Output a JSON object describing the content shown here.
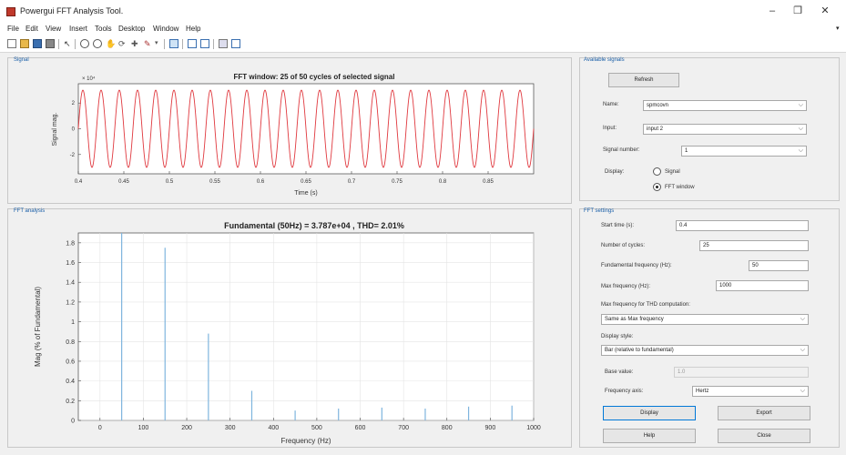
{
  "window": {
    "title": "Powergui FFT Analysis Tool.",
    "minimize": "–",
    "maximize": "❐",
    "close": "✕"
  },
  "menu": [
    "File",
    "Edit",
    "View",
    "Insert",
    "Tools",
    "Desktop",
    "Window",
    "Help"
  ],
  "signal_panel": {
    "title": "Signal",
    "plot_title": "FFT window: 25 of 50 cycles of selected signal",
    "exponent": "× 10⁴",
    "ylabel": "Signal mag.",
    "xlabel": "Time (s)",
    "xticks": [
      "0.4",
      "0.45",
      "0.5",
      "0.55",
      "0.6",
      "0.65",
      "0.7",
      "0.75",
      "0.8",
      "0.85"
    ],
    "yticks": [
      "2",
      "0",
      "-2"
    ]
  },
  "fft_panel": {
    "title": "FFT analysis",
    "plot_title": "Fundamental (50Hz) = 3.787e+04 , THD= 2.01%",
    "ylabel": "Mag (% of Fundamental)",
    "xlabel": "Frequency (Hz)"
  },
  "available_signals": {
    "title": "Available signals",
    "refresh": "Refresh",
    "name_label": "Name:",
    "name_value": "spmcovn",
    "input_label": "Input:",
    "input_value": "input 2",
    "signal_number_label": "Signal number:",
    "signal_number_value": "1",
    "display_label": "Display:",
    "option_signal": "Signal",
    "option_fft": "FFT window",
    "selected_option": "FFT window"
  },
  "fft_settings": {
    "title": "FFT settings",
    "start_time_label": "Start time (s):",
    "start_time_value": "0.4",
    "cycles_label": "Number of cycles:",
    "cycles_value": "25",
    "fund_freq_label": "Fundamental frequency (Hz):",
    "fund_freq_value": "50",
    "max_freq_label": "Max frequency (Hz):",
    "max_freq_value": "1000",
    "thd_label": "Max frequency for THD computation:",
    "thd_value": "Same as Max frequency",
    "display_style_label": "Display style:",
    "display_style_value": "Bar (relative to fundamental)",
    "base_value_label": "Base value:",
    "base_value_value": "1.0",
    "freq_axis_label": "Frequency axis:",
    "freq_axis_value": "Hertz",
    "display_btn": "Display",
    "export_btn": "Export",
    "help_btn": "Help",
    "close_btn": "Close"
  },
  "colors": {
    "signal_line": "#e0393f",
    "fft_bar": "#7fb5de",
    "panel_title": "#1a5fa8"
  },
  "chart_data": [
    {
      "type": "line",
      "title": "FFT window: 25 of 50 cycles of selected signal",
      "xlabel": "Time (s)",
      "ylabel": "Signal mag.",
      "y_exponent": "× 10⁴",
      "xlim": [
        0.4,
        0.9
      ],
      "ylim": [
        -3.5,
        3.5
      ],
      "xticks": [
        0.4,
        0.45,
        0.5,
        0.55,
        0.6,
        0.65,
        0.7,
        0.75,
        0.8,
        0.85
      ],
      "yticks": [
        2,
        0,
        -2
      ],
      "series": [
        {
          "frequency_hz": 50,
          "amplitude": 3.0,
          "cycles": 25
        }
      ]
    },
    {
      "type": "bar",
      "title": "Fundamental (50Hz) = 3.787e+04 , THD= 2.01%",
      "xlabel": "Frequency (Hz)",
      "ylabel": "Mag (% of Fundamental)",
      "xlim": [
        -50,
        1000
      ],
      "ylim": [
        0,
        1.9
      ],
      "xticks": [
        0,
        100,
        200,
        300,
        400,
        500,
        600,
        700,
        800,
        900,
        1000
      ],
      "yticks": [
        0,
        0.2,
        0.4,
        0.6,
        0.8,
        1,
        1.2,
        1.4,
        1.6,
        1.8
      ],
      "x": [
        50,
        150,
        250,
        350,
        450,
        550,
        650,
        750,
        850,
        950
      ],
      "values": [
        1.9,
        1.75,
        0.88,
        0.3,
        0.1,
        0.12,
        0.13,
        0.12,
        0.14,
        0.15
      ]
    }
  ]
}
